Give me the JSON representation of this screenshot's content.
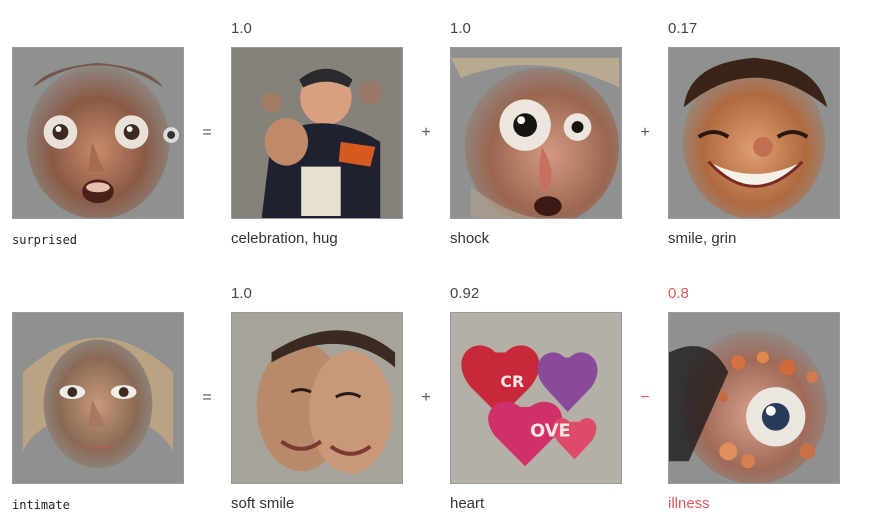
{
  "rows": [
    {
      "target_label": "surprised",
      "equals": "=",
      "terms": [
        {
          "weight": "1.0",
          "label": "celebration, hug",
          "operator": ""
        },
        {
          "weight": "1.0",
          "label": "shock",
          "operator": "+"
        },
        {
          "weight": "0.17",
          "label": "smile, grin",
          "operator": "+"
        }
      ]
    },
    {
      "target_label": "intimate",
      "equals": "=",
      "terms": [
        {
          "weight": "1.0",
          "label": "soft smile",
          "operator": ""
        },
        {
          "weight": "0.92",
          "label": "heart",
          "operator": "+"
        },
        {
          "weight": "0.8",
          "label": "illness",
          "operator": "−"
        }
      ]
    }
  ],
  "colors": {
    "negative": "#e05a5a",
    "text": "#333333",
    "tile_border": "#9a9a9a"
  }
}
